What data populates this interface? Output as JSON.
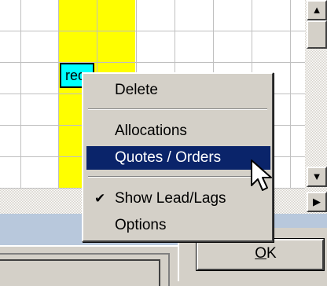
{
  "grid": {
    "cell_tag": "req"
  },
  "scrollbar": {
    "up_arrow": "▲",
    "down_arrow": "▼",
    "right_arrow": "▶"
  },
  "context_menu": {
    "items": [
      {
        "label": "Delete"
      },
      {
        "label": "Allocations"
      },
      {
        "label": "Quotes / Orders",
        "highlighted": true
      },
      {
        "label": "Show Lead/Lags",
        "checked": true,
        "check_glyph": "✔"
      },
      {
        "label": "Options"
      }
    ]
  },
  "ok_button": {
    "mnemonic": "O",
    "rest": "K"
  },
  "colors": {
    "highlight": "#0a246a",
    "cell_yellow": "#ffff00",
    "cell_cyan": "#00ffff",
    "menu_bg": "#d4d0c8"
  }
}
